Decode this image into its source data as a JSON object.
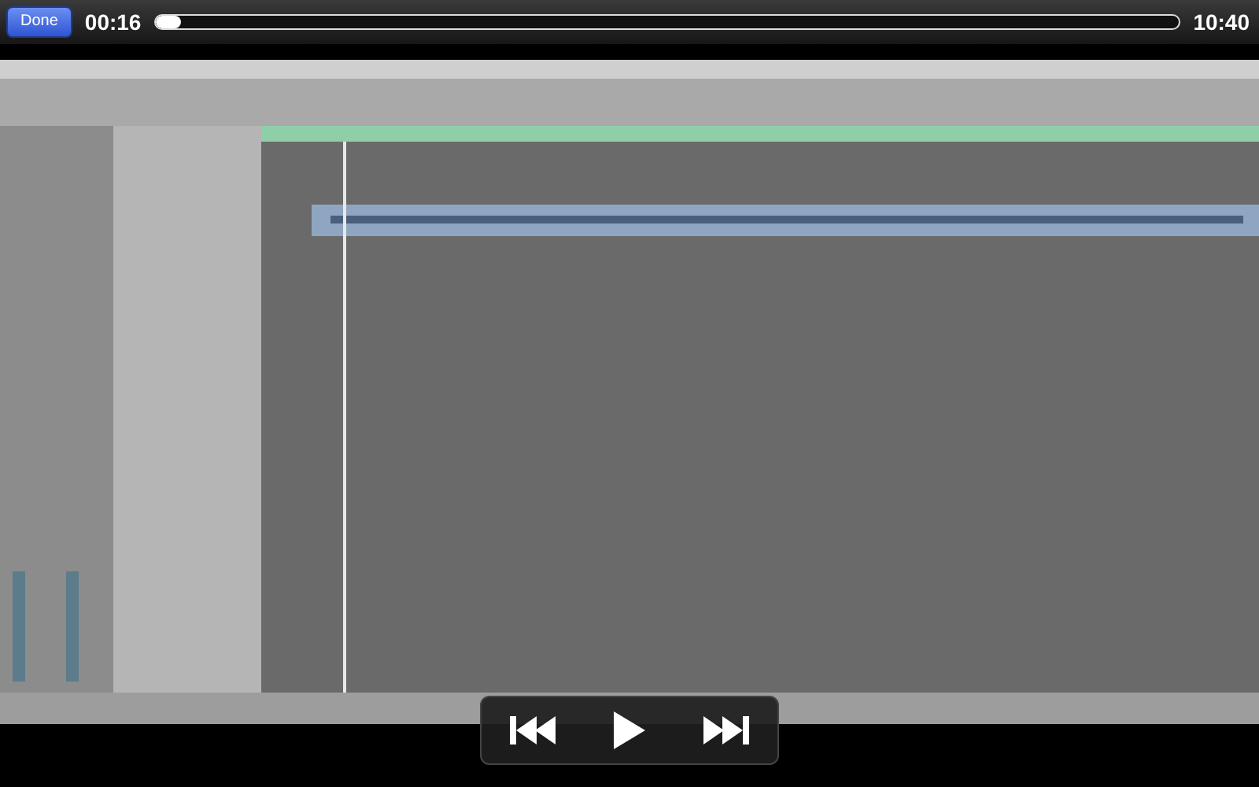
{
  "top_bar": {
    "done_button": "Done",
    "elapsed": "00:16",
    "remaining": "10:40",
    "progress": {
      "level": 0.025
    }
  },
  "controls": {
    "playing": false
  }
}
